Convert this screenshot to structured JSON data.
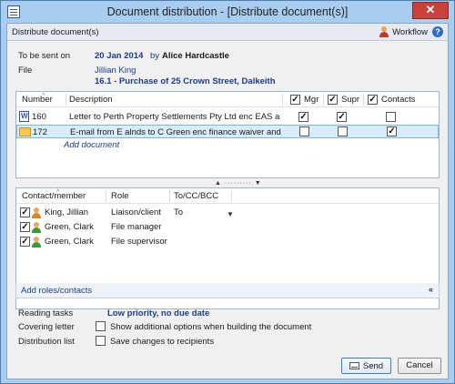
{
  "window": {
    "title": "Document distribution - [Distribute document(s)]",
    "close_symbol": "✕"
  },
  "header": {
    "title": "Distribute document(s)",
    "workflow_label": "Workflow",
    "help_symbol": "?"
  },
  "summary": {
    "sent_on_label": "To be sent on",
    "sent_on_date": "20 Jan 2014",
    "by_label": "by",
    "by_person": "Alice Hardcastle",
    "file_label": "File",
    "file_client": "Jillian King",
    "file_matter": "16.1 - Purchase of 25 Crown Street, Dalkeith"
  },
  "documents": {
    "columns": {
      "number": "Number",
      "description": "Description",
      "mgr": "Mgr",
      "supr": "Supr",
      "contacts": "Contacts"
    },
    "header_checks": {
      "mgr": true,
      "supr": true,
      "contacts": true
    },
    "rows": [
      {
        "icon": "word-document-icon",
        "number": "160",
        "description": "Letter to Perth Property Settlements Pty Ltd enc EAS and...",
        "mgr": true,
        "supr": true,
        "contacts": false,
        "selected": false
      },
      {
        "icon": "email-icon",
        "number": "172",
        "description": "E-mail from E alnds to C Green enc finance waiver and v...",
        "mgr": false,
        "supr": false,
        "contacts": true,
        "selected": true
      }
    ],
    "add_label": "Add document"
  },
  "contacts": {
    "columns": {
      "member": "Contact/member",
      "role": "Role",
      "to_cc": "To/CC/BCC"
    },
    "rows": [
      {
        "checked": true,
        "icon": "client-person-icon",
        "name": "King, Jillian",
        "role": "Liaison/client",
        "to_cc": "To",
        "has_dropdown": true
      },
      {
        "checked": true,
        "icon": "staff-person-icon",
        "name": "Green, Clark",
        "role": "File manager",
        "to_cc": "",
        "has_dropdown": false
      },
      {
        "checked": true,
        "icon": "staff-person-icon",
        "name": "Green, Clark",
        "role": "File supervisor",
        "to_cc": "",
        "has_dropdown": false
      }
    ],
    "add_roles_label": "Add roles/contacts"
  },
  "options": {
    "reading_tasks_label": "Reading tasks",
    "reading_tasks_value": "Low priority, no due date",
    "covering_letter_label": "Covering letter",
    "covering_letter_option": "Show additional options when building the document",
    "covering_letter_checked": false,
    "distribution_list_label": "Distribution list",
    "distribution_list_option": "Save changes to recipients",
    "distribution_list_checked": false
  },
  "buttons": {
    "send": "Send",
    "cancel": "Cancel"
  },
  "colors": {
    "window_frame": "#a9cdef",
    "link_blue": "#1b3c8e",
    "selection": "#d7ecfc"
  }
}
